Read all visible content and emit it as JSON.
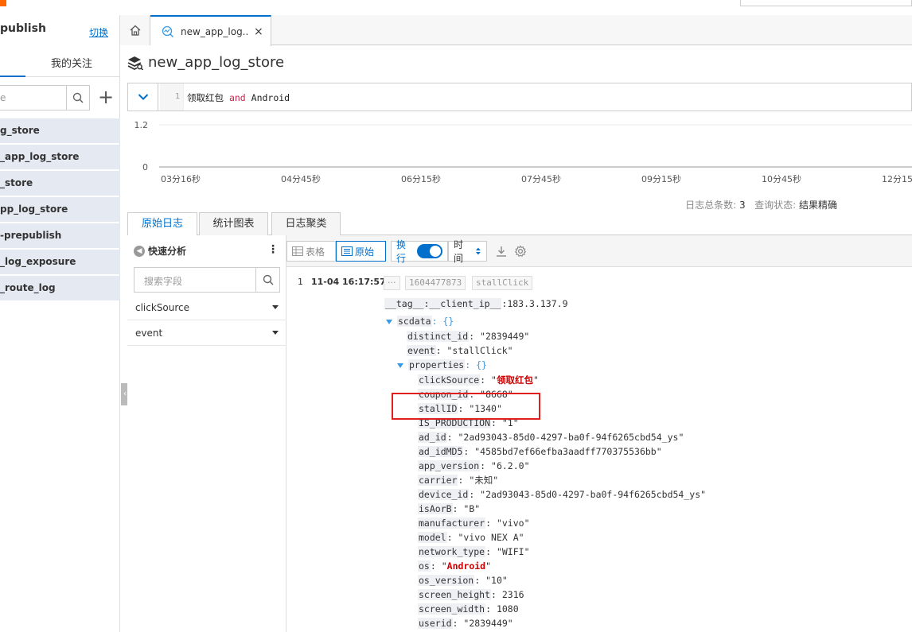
{
  "sidebar": {
    "title": "publish",
    "switch_label": "切换",
    "tab_follow": "我的关注",
    "search_placeholder": "e",
    "add_label": "+",
    "items": [
      {
        "label": "g_store"
      },
      {
        "label": "_app_log_store"
      },
      {
        "label": "_store"
      },
      {
        "label": "pp_log_store"
      },
      {
        "label": "-prepublish"
      },
      {
        "label": "_log_exposure"
      },
      {
        "label": "_route_log"
      }
    ]
  },
  "tabs": {
    "active_label": "new_app_log...",
    "close": "×"
  },
  "header": {
    "title": "new_app_log_store"
  },
  "query": {
    "line_number": "1",
    "text_before": "领取红包 ",
    "keyword": "and",
    "text_after": " Android"
  },
  "chart_data": {
    "type": "line",
    "y_ticks": [
      "1.2",
      "0"
    ],
    "x_ticks": [
      "03分16秒",
      "04分45秒",
      "06分15秒",
      "07分45秒",
      "09分15秒",
      "10分45秒",
      "12分15"
    ],
    "ylim": [
      0,
      1.2
    ],
    "series": []
  },
  "stats": {
    "count_label": "日志总条数:",
    "count_value": "3",
    "status_label": "查询状态:",
    "status_value": "结果精确"
  },
  "result_tabs": [
    {
      "label": "原始日志"
    },
    {
      "label": "统计图表"
    },
    {
      "label": "日志聚类"
    }
  ],
  "quick_analysis": {
    "title": "快速分析",
    "more": "⋮",
    "search_placeholder": "搜索字段",
    "fields": [
      {
        "label": "clickSource"
      },
      {
        "label": "event"
      }
    ]
  },
  "toolbar": {
    "table_label": "表格",
    "raw_label": "原始",
    "wrap_label": "换行",
    "time_label": "时间"
  },
  "log": {
    "index": "1",
    "time": "11-04 16:17:57",
    "chip_more": "···",
    "chip_ts": "1604477873",
    "chip_event": "stallClick",
    "tag_key": "__tag__:__client_ip__",
    "tag_val": ":183.3.137.9",
    "scdata_key": "scdata",
    "scdata_val": ": {}",
    "distinct_id_key": "distinct_id",
    "distinct_id_val": ": \"2839449\"",
    "event_key": "event",
    "event_val": ": \"stallClick\"",
    "properties_key": "properties",
    "properties_val": ": {}",
    "props": [
      {
        "key": "clickSource",
        "sep": ": \"",
        "val": "领取红包",
        "end": "\"",
        "red": true
      },
      {
        "key": "coupon_id",
        "sep": ": \"",
        "val": "8668",
        "end": "\"",
        "red": false
      },
      {
        "key": "stallID",
        "sep": ": \"",
        "val": "1340",
        "end": "\"",
        "red": false
      },
      {
        "key": "IS_PRODUCTION",
        "sep": ": \"",
        "val": "1",
        "end": "\"",
        "red": false
      },
      {
        "key": "ad_id",
        "sep": ": \"",
        "val": "2ad93043-85d0-4297-ba0f-94f6265cbd54_ys",
        "end": "\"",
        "red": false
      },
      {
        "key": "ad_idMD5",
        "sep": ": \"",
        "val": "4585bd7ef66efba3aadff770375536bb",
        "end": "\"",
        "red": false
      },
      {
        "key": "app_version",
        "sep": ": \"",
        "val": "6.2.0",
        "end": "\"",
        "red": false
      },
      {
        "key": "carrier",
        "sep": ": \"",
        "val": "未知",
        "end": "\"",
        "red": false
      },
      {
        "key": "device_id",
        "sep": ": \"",
        "val": "2ad93043-85d0-4297-ba0f-94f6265cbd54_ys",
        "end": "\"",
        "red": false
      },
      {
        "key": "isAorB",
        "sep": ": \"",
        "val": "B",
        "end": "\"",
        "red": false
      },
      {
        "key": "manufacturer",
        "sep": ": \"",
        "val": "vivo",
        "end": "\"",
        "red": false
      },
      {
        "key": "model",
        "sep": ": \"",
        "val": "vivo NEX A",
        "end": "\"",
        "red": false
      },
      {
        "key": "network_type",
        "sep": ": \"",
        "val": "WIFI",
        "end": "\"",
        "red": false
      },
      {
        "key": "os",
        "sep": ": \"",
        "val": "Android",
        "end": "\"",
        "red": true
      },
      {
        "key": "os_version",
        "sep": ": \"",
        "val": "10",
        "end": "\"",
        "red": false
      },
      {
        "key": "screen_height",
        "sep": ": ",
        "val": "2316",
        "end": "",
        "red": false
      },
      {
        "key": "screen_width",
        "sep": ": ",
        "val": "1080",
        "end": "",
        "red": false
      },
      {
        "key": "userid",
        "sep": ": \"",
        "val": "2839449",
        "end": "\"",
        "red": false
      }
    ]
  },
  "colors": {
    "accent": "#0070cc",
    "highlight_box": "#e0201e",
    "sidebar_item_bg": "#e4e9f2",
    "match_red": "#cc0000"
  }
}
